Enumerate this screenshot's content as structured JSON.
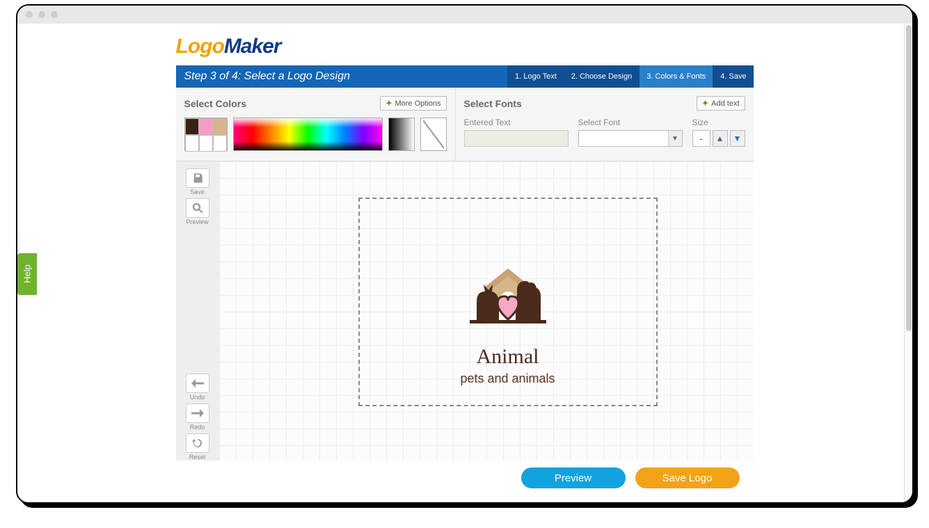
{
  "brand": {
    "part_a": "Logo",
    "part_b": "Maker"
  },
  "help_tab": "Help",
  "stepbar": {
    "title": "Step 3 of 4: Select a Logo Design",
    "tabs": [
      "1. Logo Text",
      "2. Choose Design",
      "3. Colors & Fonts",
      "4. Save"
    ],
    "active_index": 2
  },
  "colors_panel": {
    "title": "Select Colors",
    "more_btn": "More Options",
    "swatches": [
      "#3a1f12",
      "#f79bc4",
      "#d7b58a",
      "#ffffff",
      "#ffffff",
      "#ffffff"
    ]
  },
  "fonts_panel": {
    "title": "Select Fonts",
    "add_btn": "Add text",
    "labels": {
      "entered": "Entered Text",
      "font": "Select Font",
      "size": "Size"
    },
    "entered_value": "",
    "selected_font": "",
    "size_value": "-"
  },
  "toolrail": {
    "save": "Save",
    "preview": "Preview",
    "undo": "Undo",
    "redo": "Redo",
    "reset": "Reset"
  },
  "canvas": {
    "logo_title": "Animal",
    "logo_tagline": "pets and animals"
  },
  "footer": {
    "preview": "Preview",
    "save": "Save Logo"
  }
}
